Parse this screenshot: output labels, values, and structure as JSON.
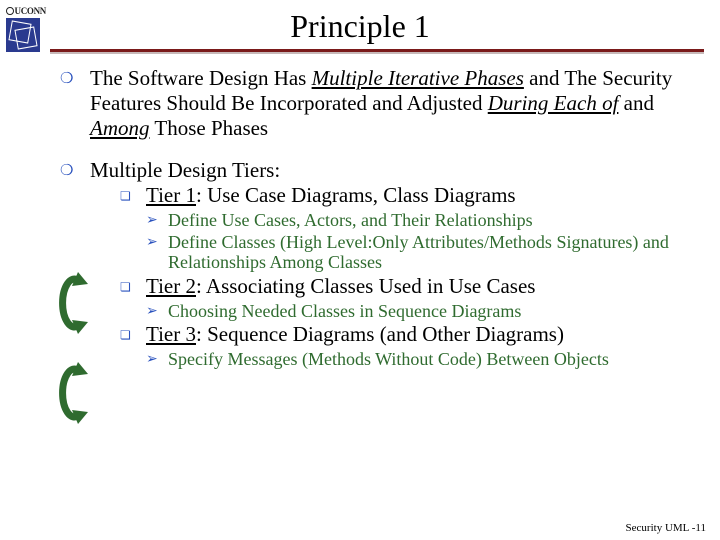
{
  "header": {
    "logo_brand": "UCONN",
    "title": "Principle 1"
  },
  "colors": {
    "rule": "#7a1a1a",
    "bullet_l1": "#2a52be",
    "bullet_l2": "#2a52be",
    "l3_text": "#2f6b2f",
    "arrow": "#2f6b2f"
  },
  "bullets": [
    {
      "prefix": "The Software Design Has ",
      "emph1": "Multiple Iterative Phases",
      "mid": " and The Security Features Should Be Incorporated and Adjusted ",
      "emph2": "During Each of",
      "mid2": " and ",
      "emph3": "Among",
      "suffix": " Those Phases"
    },
    {
      "heading": "Multiple Design Tiers:",
      "tiers": [
        {
          "label": "Tier 1",
          "rest": ": Use Case Diagrams, Class Diagrams",
          "subs": [
            "Define Use Cases, Actors, and Their Relationships",
            "Define Classes (High Level:Only Attributes/Methods Signatures) and Relationships Among Classes"
          ]
        },
        {
          "label": "Tier 2",
          "rest": ": Associating Classes Used in Use Cases",
          "subs": [
            "Choosing Needed Classes in Sequence Diagrams"
          ]
        },
        {
          "label": "Tier 3",
          "rest": ": Sequence Diagrams (and Other Diagrams)",
          "subs": [
            "Specify Messages (Methods Without Code) Between Objects"
          ]
        }
      ]
    }
  ],
  "footer": "Security UML -11"
}
